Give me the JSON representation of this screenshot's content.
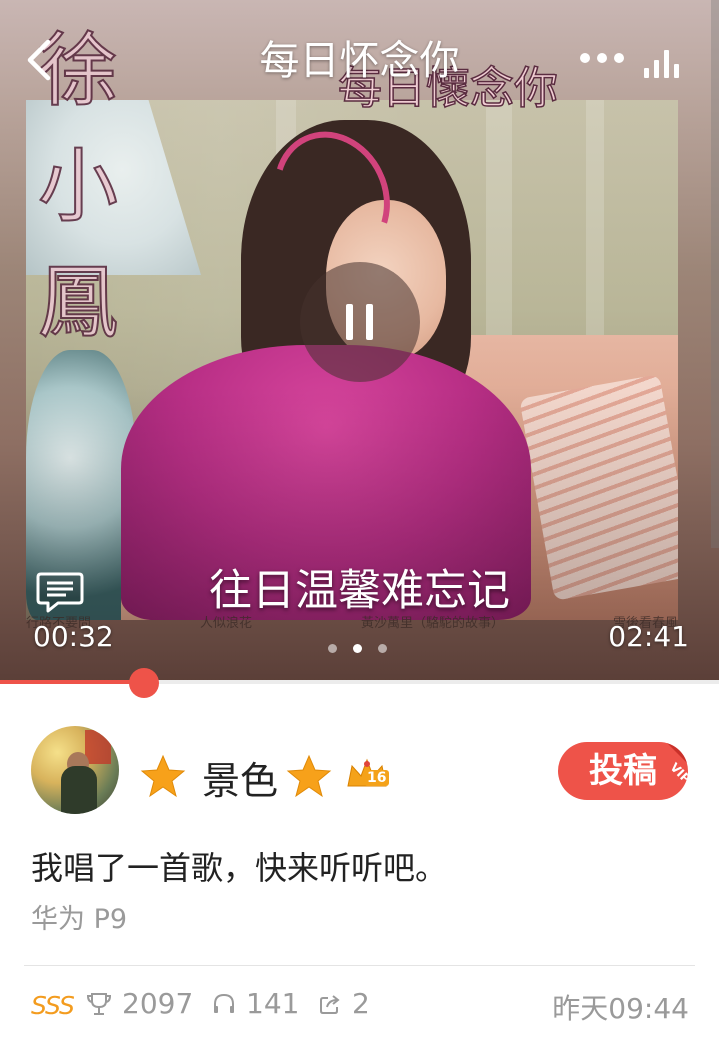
{
  "header": {
    "title": "每日怀念你"
  },
  "cover_art": {
    "logo_big": "徐小鳳",
    "logo_sub": "每日懷念你",
    "captions": [
      "行路不要問",
      "人似浪花",
      "黃沙萬里（駱駝的故事）",
      "雪後看春風"
    ]
  },
  "player": {
    "lyric": "往日温馨难忘记",
    "current_time": "00:32",
    "total_time": "02:41",
    "progress_fraction": 0.2,
    "page_indicator": {
      "count": 3,
      "active": 2
    },
    "accent_color": "#ee5349"
  },
  "profile": {
    "username": "景色",
    "level": "16",
    "submit_label": "投稿",
    "vip_label": "VIP"
  },
  "post": {
    "description": "我唱了一首歌，快来听听吧。",
    "device": "华为 P9"
  },
  "footer": {
    "rank_badge": "SSS",
    "trophy_count": "2097",
    "listen_count": "141",
    "share_count": "2",
    "date": "昨天09:44"
  },
  "icons": [
    "back-icon",
    "more-icon",
    "stats-icon",
    "pause-icon",
    "comment-icon",
    "star-icon",
    "crown-icon",
    "trophy-icon",
    "headphones-icon",
    "share-icon"
  ]
}
